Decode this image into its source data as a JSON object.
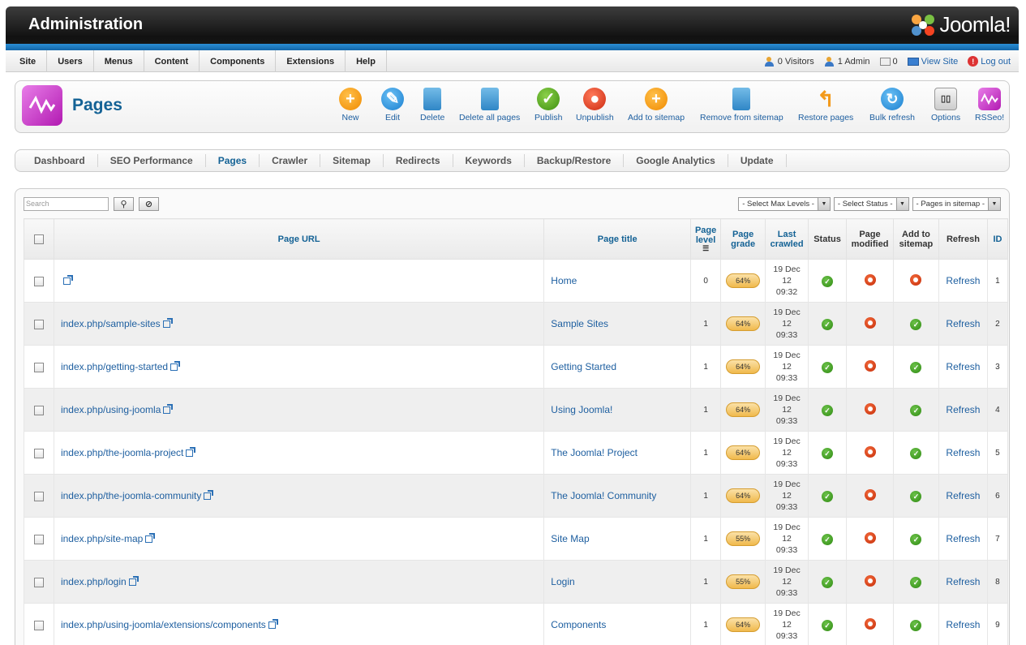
{
  "header": {
    "title": "Administration",
    "logo_text": "Joomla!"
  },
  "menu": [
    "Site",
    "Users",
    "Menus",
    "Content",
    "Components",
    "Extensions",
    "Help"
  ],
  "status": {
    "visitors": "0 Visitors",
    "admin": "1 Admin",
    "messages": "0",
    "view_site": "View Site",
    "logout": "Log out"
  },
  "toolbar": {
    "title": "Pages",
    "buttons": [
      "New",
      "Edit",
      "Delete",
      "Delete all pages",
      "Publish",
      "Unpublish",
      "Add to sitemap",
      "Remove from sitemap",
      "Restore pages",
      "Bulk refresh",
      "Options",
      "RSSeo!"
    ]
  },
  "tabs": [
    "Dashboard",
    "SEO Performance",
    "Pages",
    "Crawler",
    "Sitemap",
    "Redirects",
    "Keywords",
    "Backup/Restore",
    "Google Analytics",
    "Update"
  ],
  "filters": {
    "search_placeholder": "Search",
    "max_levels": "- Select Max Levels -",
    "select_status": "- Select Status -",
    "pages_in_sitemap": "- Pages in sitemap -"
  },
  "table": {
    "headers": {
      "url": "Page URL",
      "title": "Page title",
      "level": "Page level",
      "grade": "Page grade",
      "crawled": "Last crawled",
      "status": "Status",
      "modified": "Page modified",
      "sitemap": "Add to sitemap",
      "refresh": "Refresh",
      "id": "ID"
    },
    "rows": [
      {
        "url": "",
        "title": "Home",
        "level": "0",
        "grade": "64%",
        "date": "19 Dec",
        "day": "12",
        "time": "09:32",
        "sitemap": "no",
        "refresh": "Refresh",
        "id": "1"
      },
      {
        "url": "index.php/sample-sites",
        "title": "Sample Sites",
        "level": "1",
        "grade": "64%",
        "date": "19 Dec",
        "day": "12",
        "time": "09:33",
        "sitemap": "yes",
        "refresh": "Refresh",
        "id": "2"
      },
      {
        "url": "index.php/getting-started",
        "title": "Getting Started",
        "level": "1",
        "grade": "64%",
        "date": "19 Dec",
        "day": "12",
        "time": "09:33",
        "sitemap": "yes",
        "refresh": "Refresh",
        "id": "3"
      },
      {
        "url": "index.php/using-joomla",
        "title": "Using Joomla!",
        "level": "1",
        "grade": "64%",
        "date": "19 Dec",
        "day": "12",
        "time": "09:33",
        "sitemap": "yes",
        "refresh": "Refresh",
        "id": "4"
      },
      {
        "url": "index.php/the-joomla-project",
        "title": "The Joomla! Project",
        "level": "1",
        "grade": "64%",
        "date": "19 Dec",
        "day": "12",
        "time": "09:33",
        "sitemap": "yes",
        "refresh": "Refresh",
        "id": "5"
      },
      {
        "url": "index.php/the-joomla-community",
        "title": "The Joomla! Community",
        "level": "1",
        "grade": "64%",
        "date": "19 Dec",
        "day": "12",
        "time": "09:33",
        "sitemap": "yes",
        "refresh": "Refresh",
        "id": "6"
      },
      {
        "url": "index.php/site-map",
        "title": "Site Map",
        "level": "1",
        "grade": "55%",
        "date": "19 Dec",
        "day": "12",
        "time": "09:33",
        "sitemap": "yes",
        "refresh": "Refresh",
        "id": "7"
      },
      {
        "url": "index.php/login",
        "title": "Login",
        "level": "1",
        "grade": "55%",
        "date": "19 Dec",
        "day": "12",
        "time": "09:33",
        "sitemap": "yes",
        "refresh": "Refresh",
        "id": "8"
      },
      {
        "url": "index.php/using-joomla/extensions/components",
        "title": "Components",
        "level": "1",
        "grade": "64%",
        "date": "19 Dec",
        "day": "12",
        "time": "09:33",
        "sitemap": "yes",
        "refresh": "Refresh",
        "id": "9"
      }
    ]
  }
}
